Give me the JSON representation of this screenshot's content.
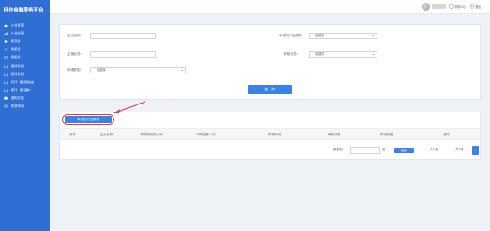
{
  "sidebar": {
    "brand": "科技金融服务平台",
    "items": [
      {
        "label": "企业首页",
        "icon": "home-icon"
      },
      {
        "label": "企业信息",
        "icon": "chart-icon"
      },
      {
        "label": "找项目",
        "icon": "building-icon"
      },
      {
        "label": "找投资",
        "icon": "wifi-icon"
      },
      {
        "label": "找担保",
        "icon": "doc-icon"
      },
      {
        "label": "耀邦计划",
        "icon": "grid-icon"
      },
      {
        "label": "瞪羚计划",
        "icon": "grid-icon"
      },
      {
        "label": "担行 “融资快速”",
        "icon": "grid-icon"
      },
      {
        "label": "建行 “惠懂你”",
        "icon": "grid-icon"
      },
      {
        "label": "通知公告",
        "icon": "bell-icon"
      },
      {
        "label": "修改密码",
        "icon": "gear-icon"
      }
    ]
  },
  "header": {
    "help_label": "帮助中心",
    "logout_label": "退出"
  },
  "form": {
    "company_name_label": "企业名称:",
    "product_label": "申请的产品服务:",
    "subject_label": "主营业务:",
    "review_status_label": "审核状态:",
    "apply_type_label": "申请类型:",
    "product_select": "请选择",
    "review_select": "请选择",
    "apply_type_select": "请选择",
    "query_button": "查 询"
  },
  "tab": {
    "label": "申请的产品服务"
  },
  "table": {
    "columns": [
      "序号",
      "企业名称",
      "申请的服务公司",
      "申请金额（万）",
      "申请时间",
      "审核状态",
      "申请类型",
      "操作"
    ]
  },
  "pager": {
    "goto_label": "跳转到",
    "page_unit": "页",
    "confirm": "确定",
    "total_pages": "共1页",
    "total_records": "共0条",
    "next": "›"
  },
  "colors": {
    "sidebar": "#2f6fd4",
    "primary": "#3b82e8",
    "annotation": "#e53935"
  }
}
